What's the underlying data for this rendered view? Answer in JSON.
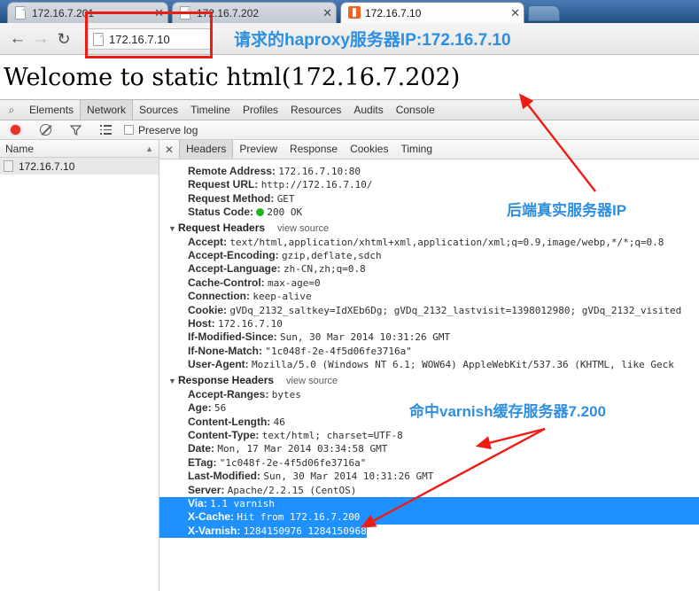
{
  "browser": {
    "tabs": [
      {
        "title": "172.16.7.201",
        "favicon": "page-icon",
        "active": false,
        "close": "✕"
      },
      {
        "title": "172.16.7.202",
        "favicon": "page-icon",
        "active": false,
        "close": "✕"
      },
      {
        "title": "172.16.7.10",
        "favicon": "magento-icon",
        "active": true,
        "close": "✕"
      }
    ],
    "nav": {
      "back": "←",
      "forward": "→",
      "reload": "↻"
    },
    "omnibox": {
      "value": "172.16.7.10",
      "favicon": "page-icon"
    }
  },
  "page": {
    "heading": "Welcome to static html(172.16.7.202)"
  },
  "annotations": [
    {
      "id": "anno-haproxy",
      "text": "请求的haproxy服务器IP:172.16.7.10",
      "color": "#2e8fe0"
    },
    {
      "id": "anno-backend",
      "text": "后端真实服务器IP",
      "color": "#2e8fe0"
    },
    {
      "id": "anno-varnish",
      "text": "命中varnish缓存服务器7.200",
      "color": "#2e8fe0"
    }
  ],
  "devtools": {
    "search_icon": "⌕",
    "panels": [
      {
        "label": "Elements",
        "selected": false
      },
      {
        "label": "Network",
        "selected": true
      },
      {
        "label": "Sources",
        "selected": false
      },
      {
        "label": "Timeline",
        "selected": false
      },
      {
        "label": "Profiles",
        "selected": false
      },
      {
        "label": "Resources",
        "selected": false
      },
      {
        "label": "Audits",
        "selected": false
      },
      {
        "label": "Console",
        "selected": false
      }
    ],
    "toolbar": {
      "record_icon": "record-icon",
      "clear_icon": "clear-icon",
      "filter_icon": "filter-icon",
      "largerows_icon": "large-rows-icon",
      "preserve_log_label": "Preserve log",
      "preserve_log_checked": false
    },
    "requests_panel": {
      "column_header": "Name",
      "sort_arrow": "▲",
      "rows": [
        {
          "name": "172.16.7.10"
        }
      ]
    },
    "detail": {
      "close_icon": "✕",
      "tabs": [
        {
          "label": "Headers",
          "selected": true
        },
        {
          "label": "Preview",
          "selected": false
        },
        {
          "label": "Response",
          "selected": false
        },
        {
          "label": "Cookies",
          "selected": false
        },
        {
          "label": "Timing",
          "selected": false
        }
      ],
      "general": [
        {
          "key": "Remote Address:",
          "value": "172.16.7.10:80"
        },
        {
          "key": "Request URL:",
          "value": "http://172.16.7.10/"
        },
        {
          "key": "Request Method:",
          "value": "GET"
        },
        {
          "key": "Status Code:",
          "value": "200 OK",
          "status": true
        }
      ],
      "request_headers_title": "Request Headers",
      "request_headers_view_source": "view source",
      "request_headers": [
        {
          "key": "Accept:",
          "value": "text/html,application/xhtml+xml,application/xml;q=0.9,image/webp,*/*;q=0.8"
        },
        {
          "key": "Accept-Encoding:",
          "value": "gzip,deflate,sdch"
        },
        {
          "key": "Accept-Language:",
          "value": "zh-CN,zh;q=0.8"
        },
        {
          "key": "Cache-Control:",
          "value": "max-age=0"
        },
        {
          "key": "Connection:",
          "value": "keep-alive"
        },
        {
          "key": "Cookie:",
          "value": "gVDq_2132_saltkey=IdXEb6Dg; gVDq_2132_lastvisit=1398012980; gVDq_2132_visited"
        },
        {
          "key": "Host:",
          "value": "172.16.7.10"
        },
        {
          "key": "If-Modified-Since:",
          "value": "Sun, 30 Mar 2014 10:31:26 GMT"
        },
        {
          "key": "If-None-Match:",
          "value": "\"1c048f-2e-4f5d06fe3716a\""
        },
        {
          "key": "User-Agent:",
          "value": "Mozilla/5.0 (Windows NT 6.1; WOW64) AppleWebKit/537.36 (KHTML, like Geck"
        }
      ],
      "response_headers_title": "Response Headers",
      "response_headers_view_source": "view source",
      "response_headers": [
        {
          "key": "Accept-Ranges:",
          "value": "bytes",
          "highlight": "none"
        },
        {
          "key": "Age:",
          "value": "56",
          "highlight": "none"
        },
        {
          "key": "Content-Length:",
          "value": "46",
          "highlight": "none"
        },
        {
          "key": "Content-Type:",
          "value": "text/html; charset=UTF-8",
          "highlight": "none"
        },
        {
          "key": "Date:",
          "value": "Mon, 17 Mar 2014 03:34:58 GMT",
          "highlight": "none"
        },
        {
          "key": "ETag:",
          "value": "\"1c048f-2e-4f5d06fe3716a\"",
          "highlight": "none"
        },
        {
          "key": "Last-Modified:",
          "value": "Sun, 30 Mar 2014 10:31:26 GMT",
          "highlight": "none"
        },
        {
          "key": "Server:",
          "value": "Apache/2.2.15 (CentOS)",
          "highlight": "none"
        },
        {
          "key": "Via:",
          "value": "1.1 varnish",
          "highlight": "full"
        },
        {
          "key": "X-Cache:",
          "value": "Hit from 172.16.7.200",
          "highlight": "full"
        },
        {
          "key": "X-Varnish:",
          "value": "1284150976 1284150968",
          "highlight": "fit"
        }
      ]
    }
  },
  "colors": {
    "accent_blue": "#2e8fe0",
    "annotation_red": "#ee1c12",
    "selection_blue": "#1e90ff",
    "status_green": "#1db51d",
    "magento_orange": "#f26322"
  }
}
